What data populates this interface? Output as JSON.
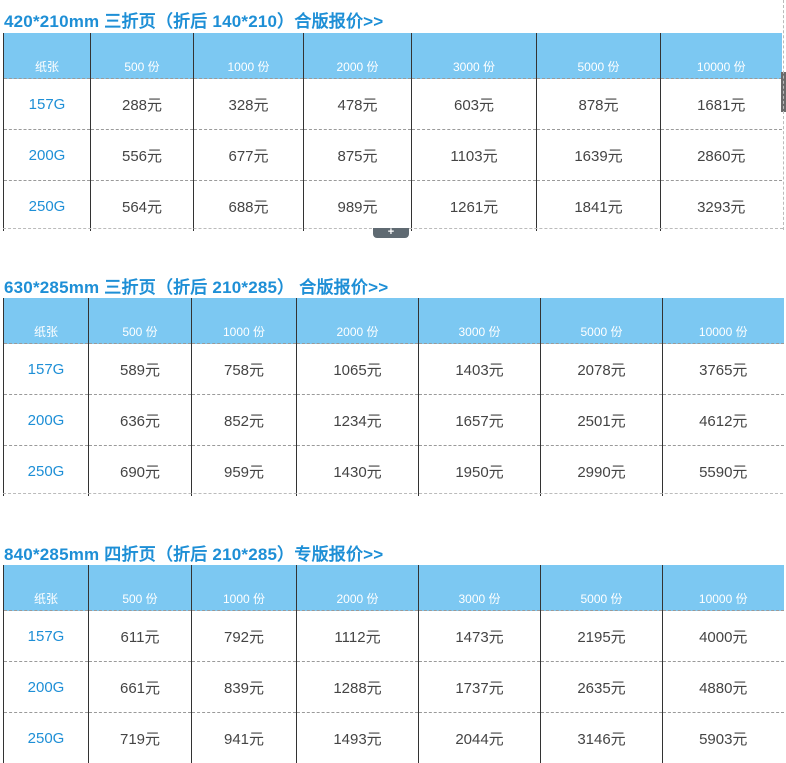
{
  "sections": [
    {
      "title": "420*210mm 三折页（折后 140*210）合版报价>>",
      "headers": [
        "纸张",
        "500 份",
        "1000 份",
        "2000 份",
        "3000 份",
        "5000 份",
        "10000 份"
      ],
      "rows": [
        [
          "157G",
          "288元",
          "328元",
          "478元",
          "603元",
          "878元",
          "1681元"
        ],
        [
          "200G",
          "556元",
          "677元",
          "875元",
          "1103元",
          "1639元",
          "2860元"
        ],
        [
          "250G",
          "564元",
          "688元",
          "989元",
          "1261元",
          "1841元",
          "3293元"
        ]
      ]
    },
    {
      "title": "630*285mm 三折页（折后 210*285） 合版报价>>",
      "headers": [
        "纸张",
        "500 份",
        "1000 份",
        "2000 份",
        "3000 份",
        "5000 份",
        "10000 份"
      ],
      "rows": [
        [
          "157G",
          "589元",
          "758元",
          "1065元",
          "1403元",
          "2078元",
          "3765元"
        ],
        [
          "200G",
          "636元",
          "852元",
          "1234元",
          "1657元",
          "2501元",
          "4612元"
        ],
        [
          "250G",
          "690元",
          "959元",
          "1430元",
          "1950元",
          "2990元",
          "5590元"
        ]
      ]
    },
    {
      "title": "840*285mm 四折页（折后 210*285）专版报价>>",
      "headers": [
        "纸张",
        "500 份",
        "1000 份",
        "2000 份",
        "3000 份",
        "5000 份",
        "10000 份"
      ],
      "rows": [
        [
          "157G",
          "611元",
          "792元",
          "1112元",
          "1473元",
          "2195元",
          "4000元"
        ],
        [
          "200G",
          "661元",
          "839元",
          "1288元",
          "1737元",
          "2635元",
          "4880元"
        ],
        [
          "250G",
          "719元",
          "941元",
          "1493元",
          "2044元",
          "3146元",
          "5903元"
        ]
      ]
    }
  ],
  "add_tab_icon": "plus-icon",
  "add_tab_symbol": "+"
}
